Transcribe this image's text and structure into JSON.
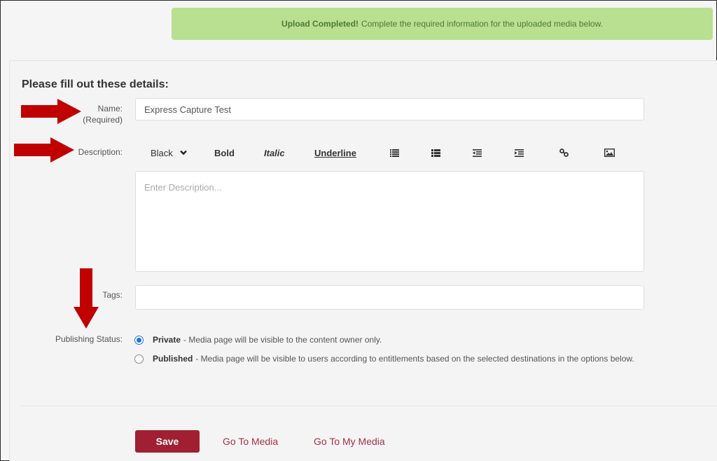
{
  "alert": {
    "strong": "Upload Completed!",
    "message": "Complete the required information for the uploaded media below.",
    "color": "#b9df90"
  },
  "form": {
    "heading": "Please fill out these details:",
    "name": {
      "label": "Name:",
      "sublabel": "(Required)",
      "value": "Express Capture Test"
    },
    "description": {
      "label": "Description:",
      "placeholder": "Enter Description...",
      "value": "",
      "toolbar": {
        "color_select": "Black",
        "bold": "Bold",
        "italic": "Italic",
        "underline": "Underline",
        "icons": [
          "ordered-list-icon",
          "unordered-list-icon",
          "outdent-icon",
          "indent-icon",
          "link-icon",
          "image-icon"
        ]
      }
    },
    "tags": {
      "label": "Tags:",
      "value": ""
    },
    "publishing_status": {
      "label": "Publishing Status:",
      "selected": "Private",
      "options": [
        {
          "title": "Private",
          "description": "- Media page will be visible to the content owner only.",
          "checked": true
        },
        {
          "title": "Published",
          "description": "- Media page will be visible to users according to entitlements based on the selected destinations in the options below.",
          "checked": false
        }
      ]
    }
  },
  "actions": {
    "save": "Save",
    "go_to_media": "Go To Media",
    "go_to_my_media": "Go To My Media",
    "accent_color": "#a01f33"
  },
  "annotations": {
    "arrow_color": "#c00000"
  }
}
